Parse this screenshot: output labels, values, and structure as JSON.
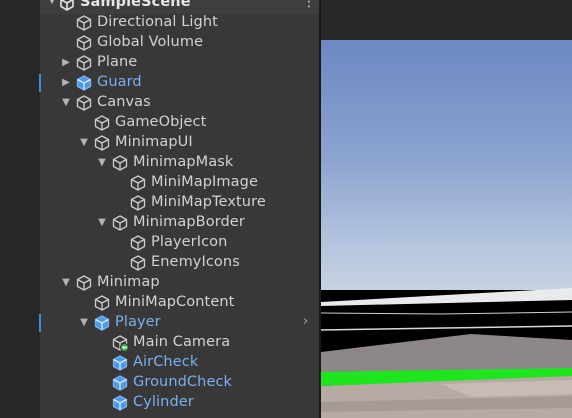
{
  "hierarchy": {
    "scene_name": "SampleScene",
    "menu_icon": "kebab-menu-icon",
    "items": [
      {
        "label": "Directional Light",
        "prefab": false
      },
      {
        "label": "Global Volume",
        "prefab": false
      },
      {
        "label": "Plane",
        "prefab": false,
        "expandable": true,
        "expanded": false
      },
      {
        "label": "Guard",
        "prefab": true,
        "expandable": true,
        "expanded": false
      },
      {
        "label": "Canvas",
        "prefab": false,
        "expandable": true,
        "expanded": true
      },
      {
        "label": "GameObject",
        "prefab": false
      },
      {
        "label": "MinimapUI",
        "prefab": false,
        "expandable": true,
        "expanded": true
      },
      {
        "label": "MinimapMask",
        "prefab": false,
        "expandable": true,
        "expanded": true
      },
      {
        "label": "MiniMapImage",
        "prefab": false
      },
      {
        "label": "MiniMapTexture",
        "prefab": false
      },
      {
        "label": "MinimapBorder",
        "prefab": false,
        "expandable": true,
        "expanded": true
      },
      {
        "label": "PlayerIcon",
        "prefab": false
      },
      {
        "label": "EnemyIcons",
        "prefab": false
      },
      {
        "label": "Minimap",
        "prefab": false,
        "expandable": true,
        "expanded": true
      },
      {
        "label": "MiniMapContent",
        "prefab": false
      },
      {
        "label": "Player",
        "prefab": true,
        "expandable": true,
        "expanded": true
      },
      {
        "label": "Main Camera",
        "prefab": false,
        "icon": "camera-gameobject-icon"
      },
      {
        "label": "AirCheck",
        "prefab": true
      },
      {
        "label": "GroundCheck",
        "prefab": true
      },
      {
        "label": "Cylinder",
        "prefab": true
      }
    ]
  },
  "colors": {
    "panel_bg": "#383838",
    "text": "#d2d2d2",
    "prefab_text": "#7bafef",
    "selection_marker": "#3d8ee0",
    "ground_green": "#1ee61e",
    "ground_tan": "#b7aaa4"
  }
}
